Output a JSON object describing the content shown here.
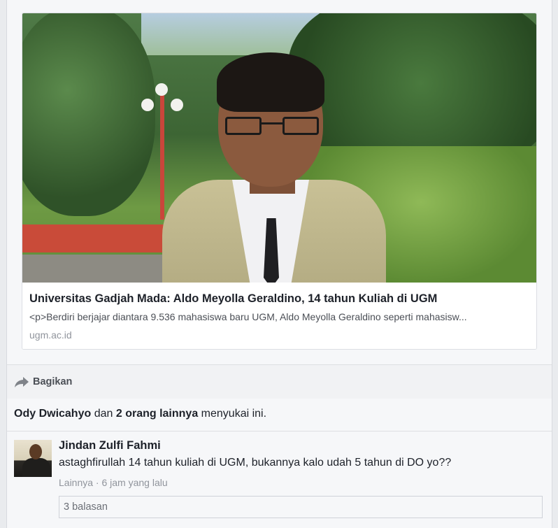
{
  "link_preview": {
    "title": "Universitas Gadjah Mada: Aldo Meyolla Geraldino, 14 tahun Kuliah di UGM",
    "description": "<p>Berdiri berjajar diantara 9.536 mahasiswa baru UGM, Aldo Meyolla Geraldino seperti mahasisw...",
    "domain": "ugm.ac.id"
  },
  "share": {
    "label": "Bagikan",
    "icon": "share-arrow-icon"
  },
  "likes": {
    "first_name": "Ody Dwicahyo",
    "conjunction": " dan ",
    "others": "2 orang lainnya",
    "suffix": " menyukai ini."
  },
  "comment": {
    "author": "Jindan Zulfi Fahmi",
    "text": "astaghfirullah 14 tahun kuliah di UGM, bukannya kalo udah 5 tahun di DO yo??",
    "meta": "Lainnya · 6 jam yang lalu",
    "replies_label": "3 balasan"
  },
  "colors": {
    "background": "#e9ebee",
    "card": "#f6f7f9",
    "text_primary": "#1d2129",
    "text_secondary": "#90949c"
  }
}
